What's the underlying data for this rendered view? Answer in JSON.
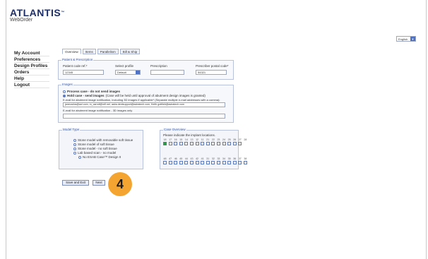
{
  "logo": {
    "brand": "ATLANTIS",
    "tm": "™",
    "sub": "WebOrder"
  },
  "language": {
    "selected": "English"
  },
  "nav": {
    "items": [
      {
        "label": "My Account"
      },
      {
        "label": "Preferences"
      },
      {
        "label": "Design Profiles"
      },
      {
        "label": "Orders"
      },
      {
        "label": "Help"
      },
      {
        "label": "Logout"
      }
    ]
  },
  "tabs": [
    {
      "label": "Overview"
    },
    {
      "label": "Items"
    },
    {
      "label": "Parallelism"
    },
    {
      "label": "Bill & Ship"
    }
  ],
  "patient": {
    "title": "Patient & Prescription",
    "patient_code_label": "Patient code ref.*",
    "patient_code_value": "12345",
    "profile_label": "Select profile",
    "profile_value": "Default",
    "prescription_label": "Prescription",
    "prescription_value": "",
    "postal_label": "Prescriber postal code*",
    "postal_value": "54321"
  },
  "images": {
    "title": "Images",
    "option_process": "Process case - do not send images",
    "option_hold": "Hold case - send images",
    "option_hold_note": "(Case will be held until approval of abutment design images is granted)",
    "email_help": "E-mail for abutment image notification, including 3D images if applicable* (Separate multiple e-mail addresses with a comma):",
    "email_value": "janecarlos@aol.com, m_carroll@mfl.net, astra.dentsupport@astratech.com, Keith.gottlieb@astratech.com",
    "email_3d_label": "E-mail for abutment image notification - 3D images only",
    "email_3d_value": ""
  },
  "model": {
    "title": "Model Type",
    "options": [
      "Stone model with removable soft tissue",
      "Stone model of soft tissue",
      "Stone model - no soft tissue",
      "Lab based scan - no model",
      "No ESAB Case™ Design II"
    ]
  },
  "case": {
    "title": "Case Overview",
    "instruction": "Please indicate the implant locations.",
    "upper": [
      "18",
      "17",
      "16",
      "15",
      "14",
      "13",
      "12",
      "11",
      "21",
      "22",
      "23",
      "24",
      "25",
      "26",
      "27",
      "28"
    ],
    "lower": [
      "48",
      "47",
      "46",
      "45",
      "44",
      "43",
      "42",
      "41",
      "31",
      "32",
      "33",
      "34",
      "35",
      "36",
      "37",
      "38"
    ],
    "selected_upper_index": 7
  },
  "buttons": {
    "save_exit": "Save and Exit",
    "next": "Next"
  },
  "step_badge": "4"
}
